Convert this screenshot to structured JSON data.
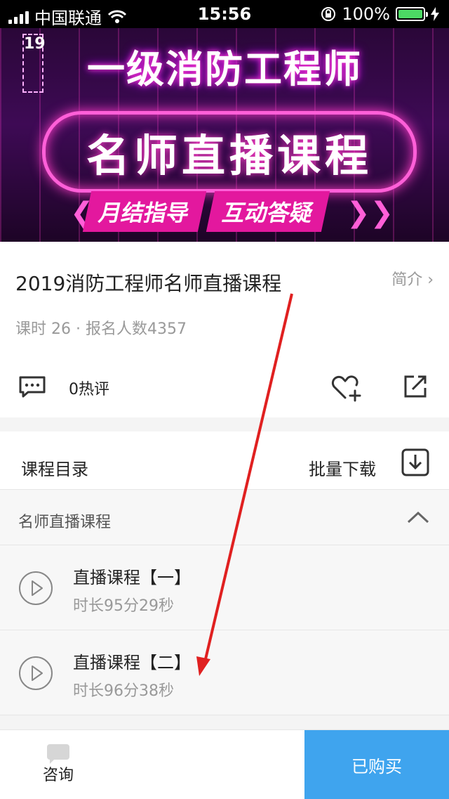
{
  "status_bar": {
    "carrier": "中国联通",
    "time": "15:56",
    "battery": "100%",
    "icons": [
      "signal-icon",
      "wifi-icon",
      "rotation-lock-icon",
      "battery-icon",
      "charging-icon"
    ]
  },
  "banner": {
    "year": "19",
    "headline": "一级消防工程师",
    "pill_text": "名师直播课程",
    "tags": [
      "月结指导",
      "互动答疑"
    ]
  },
  "course": {
    "title": "2019消防工程师名师直播课程",
    "intro_link": "简介 ›",
    "meta": "课时 26  ·  报名人数4357",
    "comment_count": "0热评"
  },
  "catalog": {
    "header_label": "课程目录",
    "batch_download_label": "批量下载",
    "section": {
      "title": "名师直播课程",
      "expanded": true
    },
    "lessons": [
      {
        "name": "直播课程【一】",
        "duration": "时长95分29秒"
      },
      {
        "name": "直播课程【二】",
        "duration": "时长96分38秒"
      }
    ]
  },
  "bottom_bar": {
    "consult_label": "咨询",
    "purchase_label": "已购买"
  },
  "colors": {
    "accent_blue": "#3fa4ee",
    "banner_neon": "#ff3cc8",
    "annotation_red": "#e02020"
  }
}
